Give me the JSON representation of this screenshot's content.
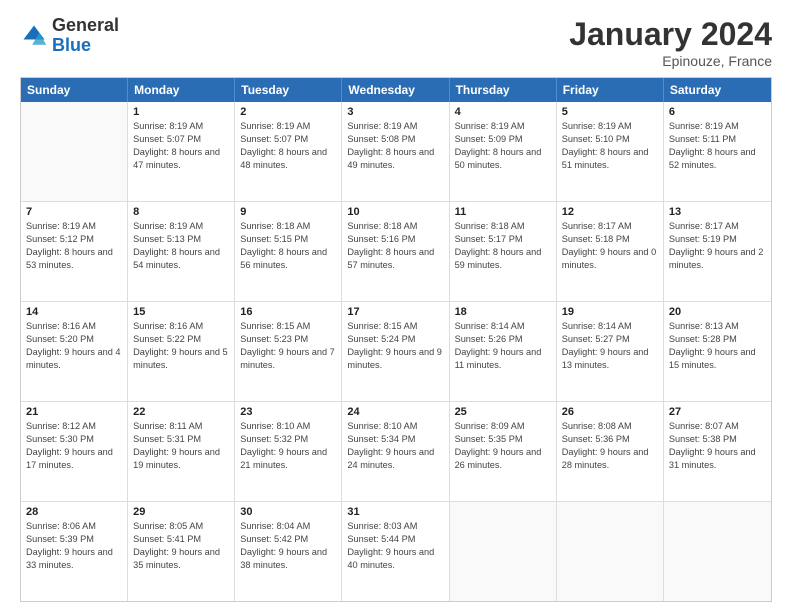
{
  "logo": {
    "general": "General",
    "blue": "Blue"
  },
  "header": {
    "month": "January 2024",
    "location": "Epinouze, France"
  },
  "weekdays": [
    "Sunday",
    "Monday",
    "Tuesday",
    "Wednesday",
    "Thursday",
    "Friday",
    "Saturday"
  ],
  "rows": [
    [
      {
        "day": "",
        "sunrise": "",
        "sunset": "",
        "daylight": ""
      },
      {
        "day": "1",
        "sunrise": "Sunrise: 8:19 AM",
        "sunset": "Sunset: 5:07 PM",
        "daylight": "Daylight: 8 hours and 47 minutes."
      },
      {
        "day": "2",
        "sunrise": "Sunrise: 8:19 AM",
        "sunset": "Sunset: 5:07 PM",
        "daylight": "Daylight: 8 hours and 48 minutes."
      },
      {
        "day": "3",
        "sunrise": "Sunrise: 8:19 AM",
        "sunset": "Sunset: 5:08 PM",
        "daylight": "Daylight: 8 hours and 49 minutes."
      },
      {
        "day": "4",
        "sunrise": "Sunrise: 8:19 AM",
        "sunset": "Sunset: 5:09 PM",
        "daylight": "Daylight: 8 hours and 50 minutes."
      },
      {
        "day": "5",
        "sunrise": "Sunrise: 8:19 AM",
        "sunset": "Sunset: 5:10 PM",
        "daylight": "Daylight: 8 hours and 51 minutes."
      },
      {
        "day": "6",
        "sunrise": "Sunrise: 8:19 AM",
        "sunset": "Sunset: 5:11 PM",
        "daylight": "Daylight: 8 hours and 52 minutes."
      }
    ],
    [
      {
        "day": "7",
        "sunrise": "Sunrise: 8:19 AM",
        "sunset": "Sunset: 5:12 PM",
        "daylight": "Daylight: 8 hours and 53 minutes."
      },
      {
        "day": "8",
        "sunrise": "Sunrise: 8:19 AM",
        "sunset": "Sunset: 5:13 PM",
        "daylight": "Daylight: 8 hours and 54 minutes."
      },
      {
        "day": "9",
        "sunrise": "Sunrise: 8:18 AM",
        "sunset": "Sunset: 5:15 PM",
        "daylight": "Daylight: 8 hours and 56 minutes."
      },
      {
        "day": "10",
        "sunrise": "Sunrise: 8:18 AM",
        "sunset": "Sunset: 5:16 PM",
        "daylight": "Daylight: 8 hours and 57 minutes."
      },
      {
        "day": "11",
        "sunrise": "Sunrise: 8:18 AM",
        "sunset": "Sunset: 5:17 PM",
        "daylight": "Daylight: 8 hours and 59 minutes."
      },
      {
        "day": "12",
        "sunrise": "Sunrise: 8:17 AM",
        "sunset": "Sunset: 5:18 PM",
        "daylight": "Daylight: 9 hours and 0 minutes."
      },
      {
        "day": "13",
        "sunrise": "Sunrise: 8:17 AM",
        "sunset": "Sunset: 5:19 PM",
        "daylight": "Daylight: 9 hours and 2 minutes."
      }
    ],
    [
      {
        "day": "14",
        "sunrise": "Sunrise: 8:16 AM",
        "sunset": "Sunset: 5:20 PM",
        "daylight": "Daylight: 9 hours and 4 minutes."
      },
      {
        "day": "15",
        "sunrise": "Sunrise: 8:16 AM",
        "sunset": "Sunset: 5:22 PM",
        "daylight": "Daylight: 9 hours and 5 minutes."
      },
      {
        "day": "16",
        "sunrise": "Sunrise: 8:15 AM",
        "sunset": "Sunset: 5:23 PM",
        "daylight": "Daylight: 9 hours and 7 minutes."
      },
      {
        "day": "17",
        "sunrise": "Sunrise: 8:15 AM",
        "sunset": "Sunset: 5:24 PM",
        "daylight": "Daylight: 9 hours and 9 minutes."
      },
      {
        "day": "18",
        "sunrise": "Sunrise: 8:14 AM",
        "sunset": "Sunset: 5:26 PM",
        "daylight": "Daylight: 9 hours and 11 minutes."
      },
      {
        "day": "19",
        "sunrise": "Sunrise: 8:14 AM",
        "sunset": "Sunset: 5:27 PM",
        "daylight": "Daylight: 9 hours and 13 minutes."
      },
      {
        "day": "20",
        "sunrise": "Sunrise: 8:13 AM",
        "sunset": "Sunset: 5:28 PM",
        "daylight": "Daylight: 9 hours and 15 minutes."
      }
    ],
    [
      {
        "day": "21",
        "sunrise": "Sunrise: 8:12 AM",
        "sunset": "Sunset: 5:30 PM",
        "daylight": "Daylight: 9 hours and 17 minutes."
      },
      {
        "day": "22",
        "sunrise": "Sunrise: 8:11 AM",
        "sunset": "Sunset: 5:31 PM",
        "daylight": "Daylight: 9 hours and 19 minutes."
      },
      {
        "day": "23",
        "sunrise": "Sunrise: 8:10 AM",
        "sunset": "Sunset: 5:32 PM",
        "daylight": "Daylight: 9 hours and 21 minutes."
      },
      {
        "day": "24",
        "sunrise": "Sunrise: 8:10 AM",
        "sunset": "Sunset: 5:34 PM",
        "daylight": "Daylight: 9 hours and 24 minutes."
      },
      {
        "day": "25",
        "sunrise": "Sunrise: 8:09 AM",
        "sunset": "Sunset: 5:35 PM",
        "daylight": "Daylight: 9 hours and 26 minutes."
      },
      {
        "day": "26",
        "sunrise": "Sunrise: 8:08 AM",
        "sunset": "Sunset: 5:36 PM",
        "daylight": "Daylight: 9 hours and 28 minutes."
      },
      {
        "day": "27",
        "sunrise": "Sunrise: 8:07 AM",
        "sunset": "Sunset: 5:38 PM",
        "daylight": "Daylight: 9 hours and 31 minutes."
      }
    ],
    [
      {
        "day": "28",
        "sunrise": "Sunrise: 8:06 AM",
        "sunset": "Sunset: 5:39 PM",
        "daylight": "Daylight: 9 hours and 33 minutes."
      },
      {
        "day": "29",
        "sunrise": "Sunrise: 8:05 AM",
        "sunset": "Sunset: 5:41 PM",
        "daylight": "Daylight: 9 hours and 35 minutes."
      },
      {
        "day": "30",
        "sunrise": "Sunrise: 8:04 AM",
        "sunset": "Sunset: 5:42 PM",
        "daylight": "Daylight: 9 hours and 38 minutes."
      },
      {
        "day": "31",
        "sunrise": "Sunrise: 8:03 AM",
        "sunset": "Sunset: 5:44 PM",
        "daylight": "Daylight: 9 hours and 40 minutes."
      },
      {
        "day": "",
        "sunrise": "",
        "sunset": "",
        "daylight": ""
      },
      {
        "day": "",
        "sunrise": "",
        "sunset": "",
        "daylight": ""
      },
      {
        "day": "",
        "sunrise": "",
        "sunset": "",
        "daylight": ""
      }
    ]
  ]
}
